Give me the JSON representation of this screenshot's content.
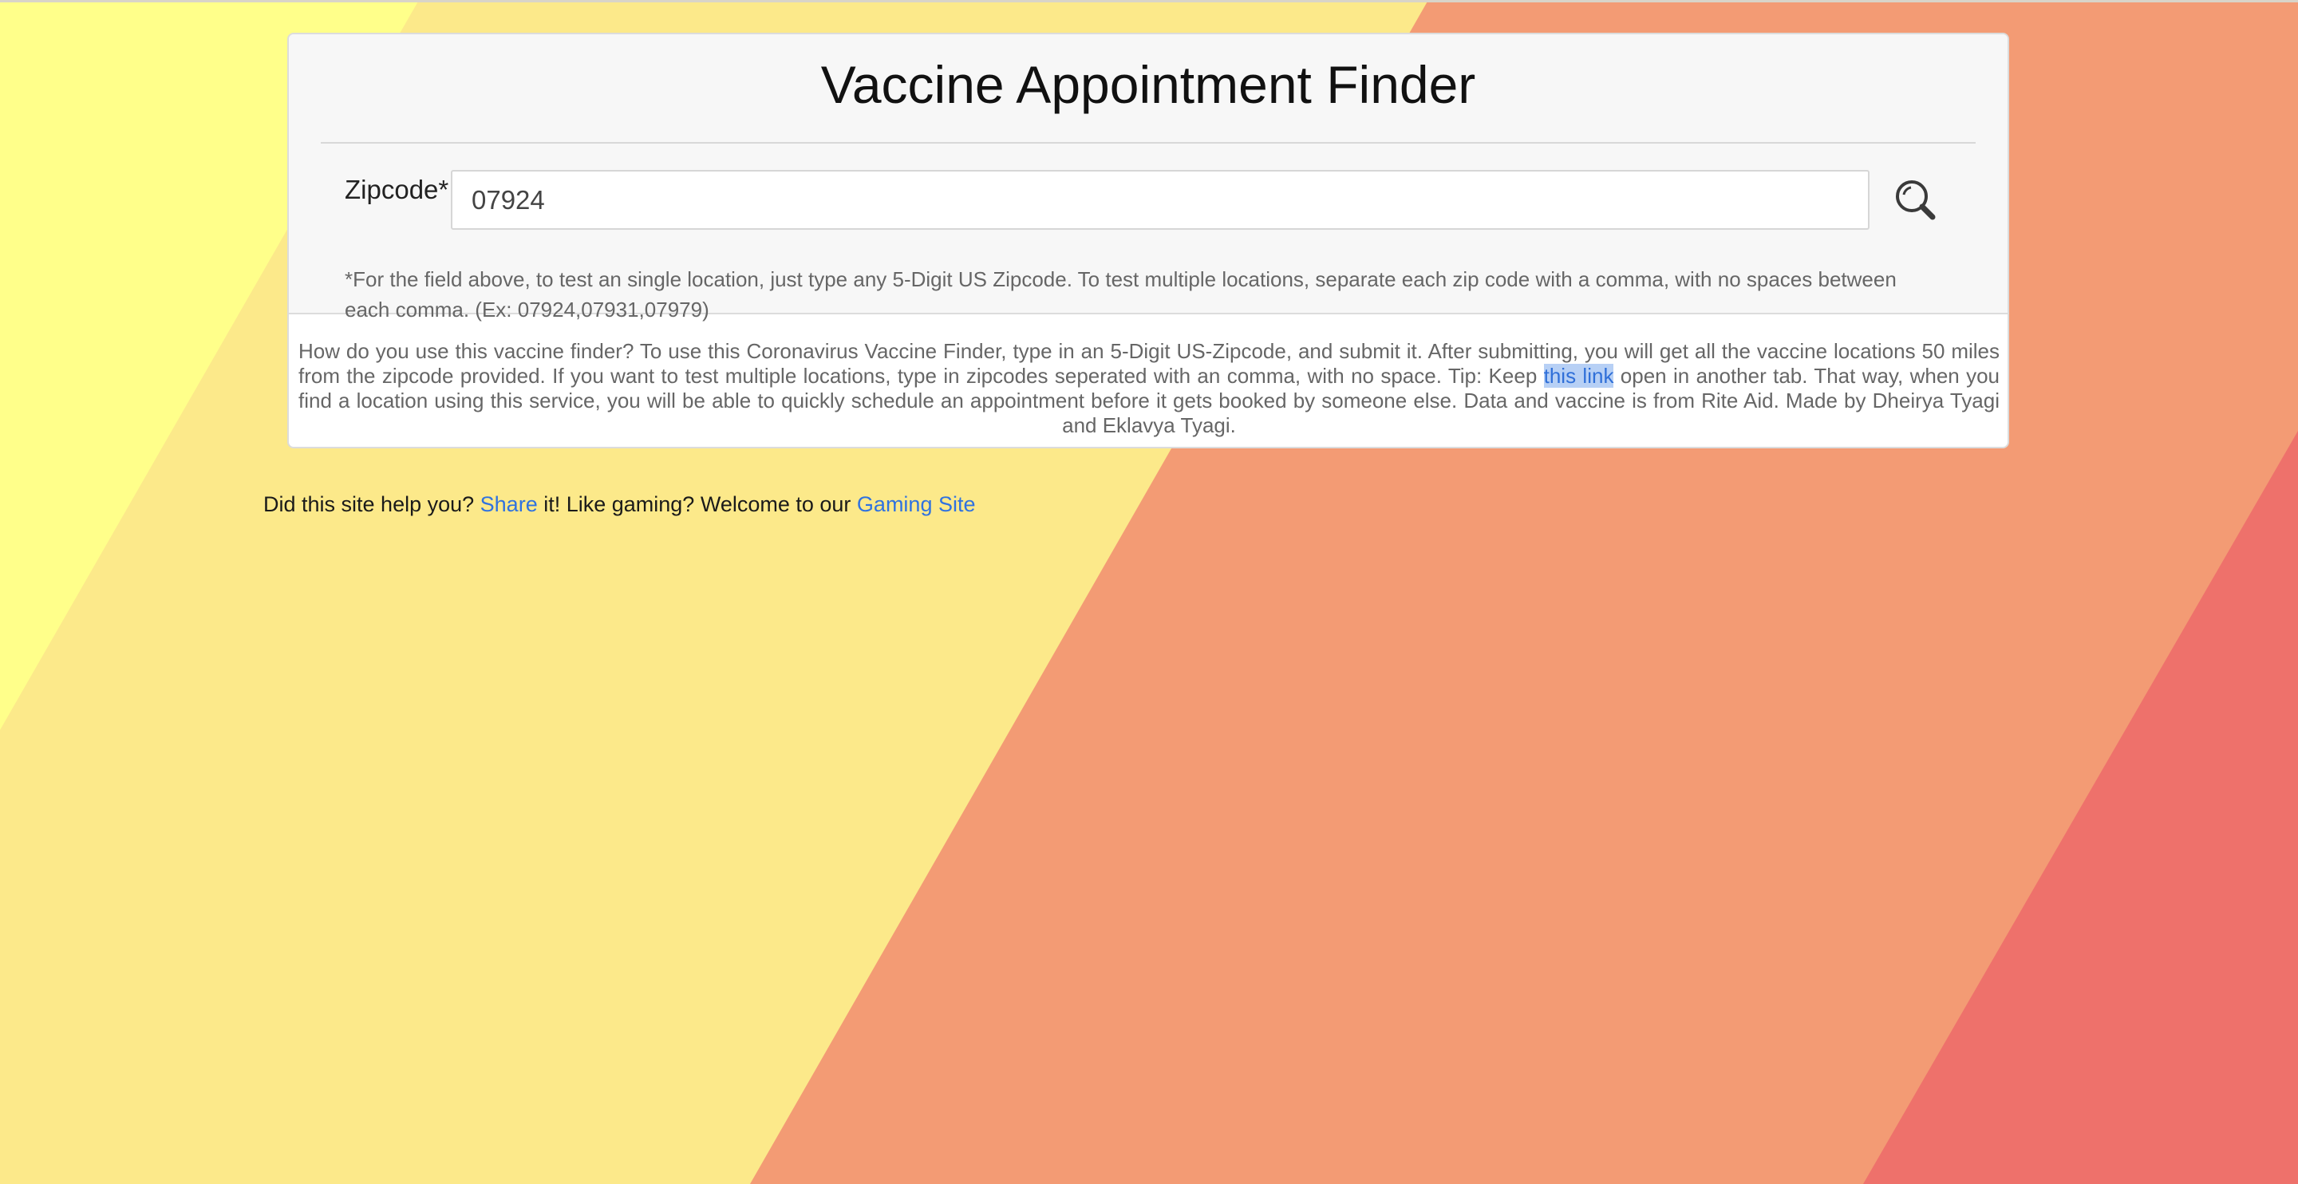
{
  "header": {
    "title": "Vaccine Appointment Finder"
  },
  "form": {
    "zip_label": "Zipcode*",
    "zip_value": "07924",
    "helper_text": "*For the field above, to test an single location, just type any 5-Digit US Zipcode. To test multiple locations, separate each zip code with a comma, with no spaces between each comma. (Ex: 07924,07931,07979)",
    "search_icon": "search-icon"
  },
  "info": {
    "text_before_link": "How do you use this vaccine finder? To use this Coronavirus Vaccine Finder, type in an 5-Digit US-Zipcode, and submit it. After submitting, you will get all the vaccine locations 50 miles from the zipcode provided. If you want to test multiple locations, type in zipcodes seperated with an comma, with no space. Tip: Keep ",
    "link_text": "this link",
    "text_after_link": " open in another tab. That way, when you find a location using this service, you will be able to quickly schedule an appointment before it gets booked by someone else. Data and vaccine is from Rite Aid. Made by Dheirya Tyagi and Eklavya Tyagi."
  },
  "footer": {
    "text_1": "Did this site help you? ",
    "share_link": "Share",
    "text_2": " it! Like gaming? Welcome to our ",
    "gaming_link": "Gaming Site"
  },
  "colors": {
    "background_yellow_light": "#ffff8a",
    "background_yellow": "#fce98a",
    "background_orange": "#f39b74",
    "background_red": "#ee716b",
    "link_blue": "#2f72e0"
  }
}
